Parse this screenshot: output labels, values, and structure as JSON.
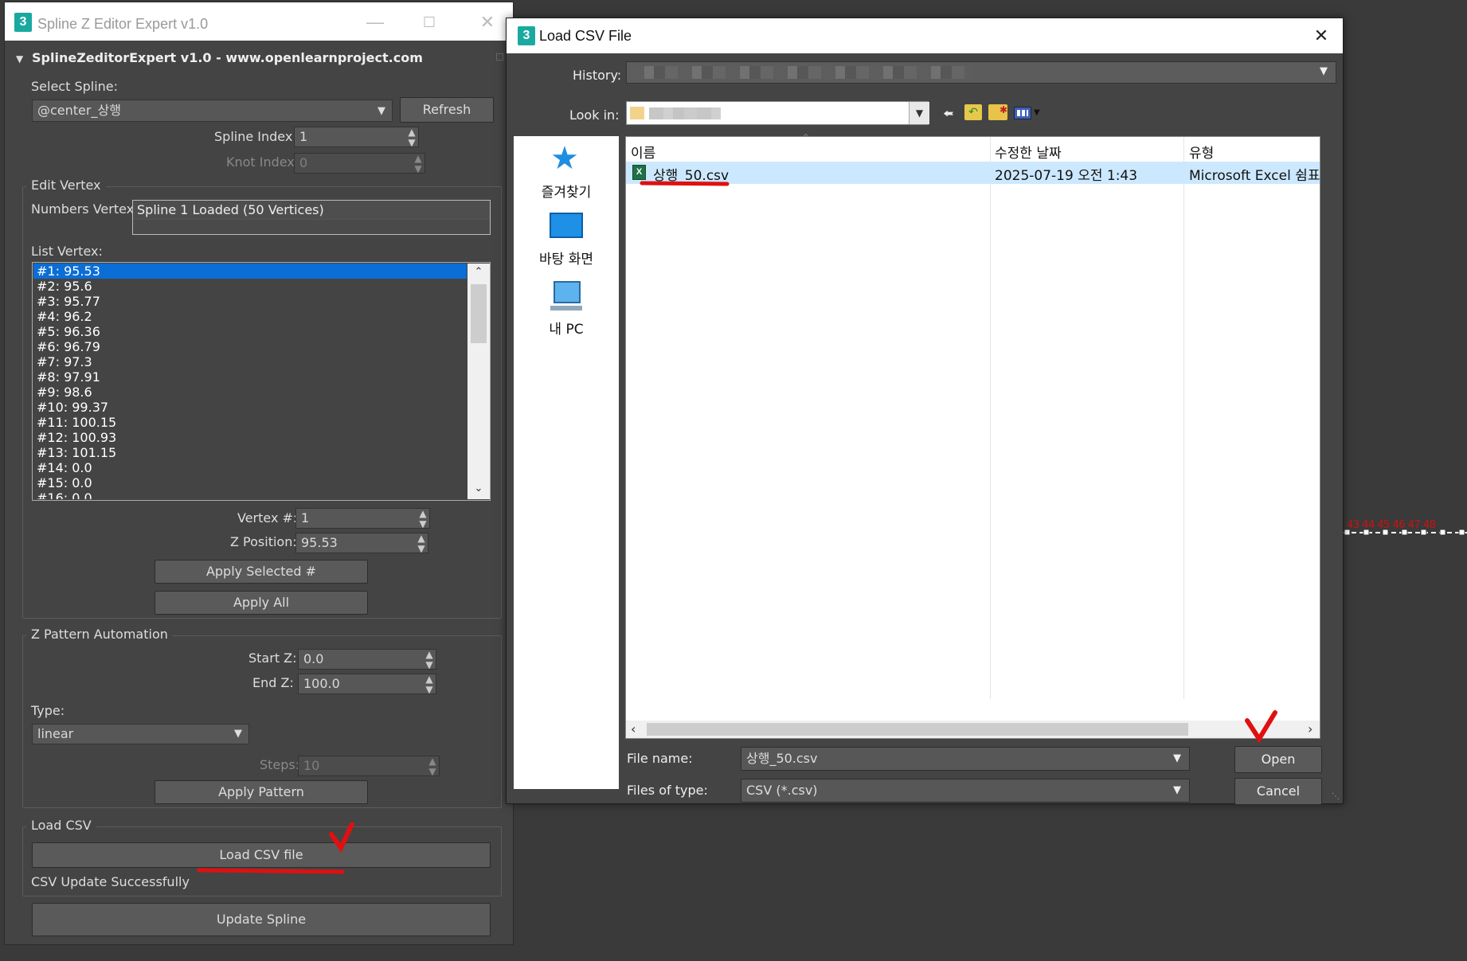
{
  "spline_editor": {
    "window_title": "Spline Z Editor Expert v1.0",
    "app_icon": "3",
    "rollout_title": "SplineZeditorExpert v1.0 - www.openlearnproject.com",
    "select_spline_label": "Select Spline:",
    "select_spline_value": "@center_상행",
    "refresh_label": "Refresh",
    "spline_index_label": "Spline Index:",
    "spline_index_value": "1",
    "knot_index_label": "Knot Index:",
    "knot_index_value": "0",
    "edit_vertex": {
      "group_title": "Edit Vertex",
      "numbers_vertex_label": "Numbers Vertex:",
      "numbers_vertex_value": "Spline 1 Loaded (50 Vertices)",
      "list_vertex_label": "List Vertex:",
      "vertices": [
        "#1: 95.53",
        "#2: 95.6",
        "#3: 95.77",
        "#4: 96.2",
        "#5: 96.36",
        "#6: 96.79",
        "#7: 97.3",
        "#8: 97.91",
        "#9: 98.6",
        "#10: 99.37",
        "#11: 100.15",
        "#12: 100.93",
        "#13: 101.15",
        "#14: 0.0",
        "#15: 0.0",
        "#16: 0.0"
      ],
      "selected_index": 0,
      "vertex_num_label": "Vertex #:",
      "vertex_num_value": "1",
      "z_position_label": "Z Position:",
      "z_position_value": "95.53",
      "apply_selected_label": "Apply Selected #",
      "apply_all_label": "Apply All"
    },
    "z_pattern": {
      "group_title": "Z Pattern Automation",
      "start_z_label": "Start Z:",
      "start_z_value": "0.0",
      "end_z_label": "End Z:",
      "end_z_value": "100.0",
      "type_label": "Type:",
      "type_value": "linear",
      "steps_label": "Steps:",
      "steps_value": "10",
      "apply_pattern_label": "Apply Pattern"
    },
    "load_csv": {
      "group_title": "Load CSV",
      "button_label": "Load CSV file",
      "status_text": "CSV Update Successfully"
    },
    "update_spline_label": "Update Spline"
  },
  "dialog": {
    "title": "Load CSV File",
    "history_label": "History:",
    "look_in_label": "Look in:",
    "places": [
      {
        "label": "즐겨찾기",
        "icon": "star-icon"
      },
      {
        "label": "바탕 화면",
        "icon": "desktop-icon"
      },
      {
        "label": "내 PC",
        "icon": "pc-icon"
      }
    ],
    "columns": [
      "이름",
      "수정한 날짜",
      "유형"
    ],
    "files": [
      {
        "name": "상행_50.csv",
        "modified": "2025-07-19 오전 1:43",
        "type": "Microsoft Excel 쉼표"
      }
    ],
    "file_name_label": "File name:",
    "file_name_value": "상행_50.csv",
    "files_of_type_label": "Files of type:",
    "files_of_type_value": "CSV (*.csv)",
    "open_label": "Open",
    "cancel_label": "Cancel"
  },
  "viewport": {
    "vertex_numbers": [
      "43",
      "44",
      "45",
      "46",
      "47",
      "48"
    ]
  },
  "colors": {
    "selection": "#0a6ed6",
    "annotation_red": "#e01010",
    "panel_bg": "#444444",
    "app_icon": "#1aa9a0"
  }
}
